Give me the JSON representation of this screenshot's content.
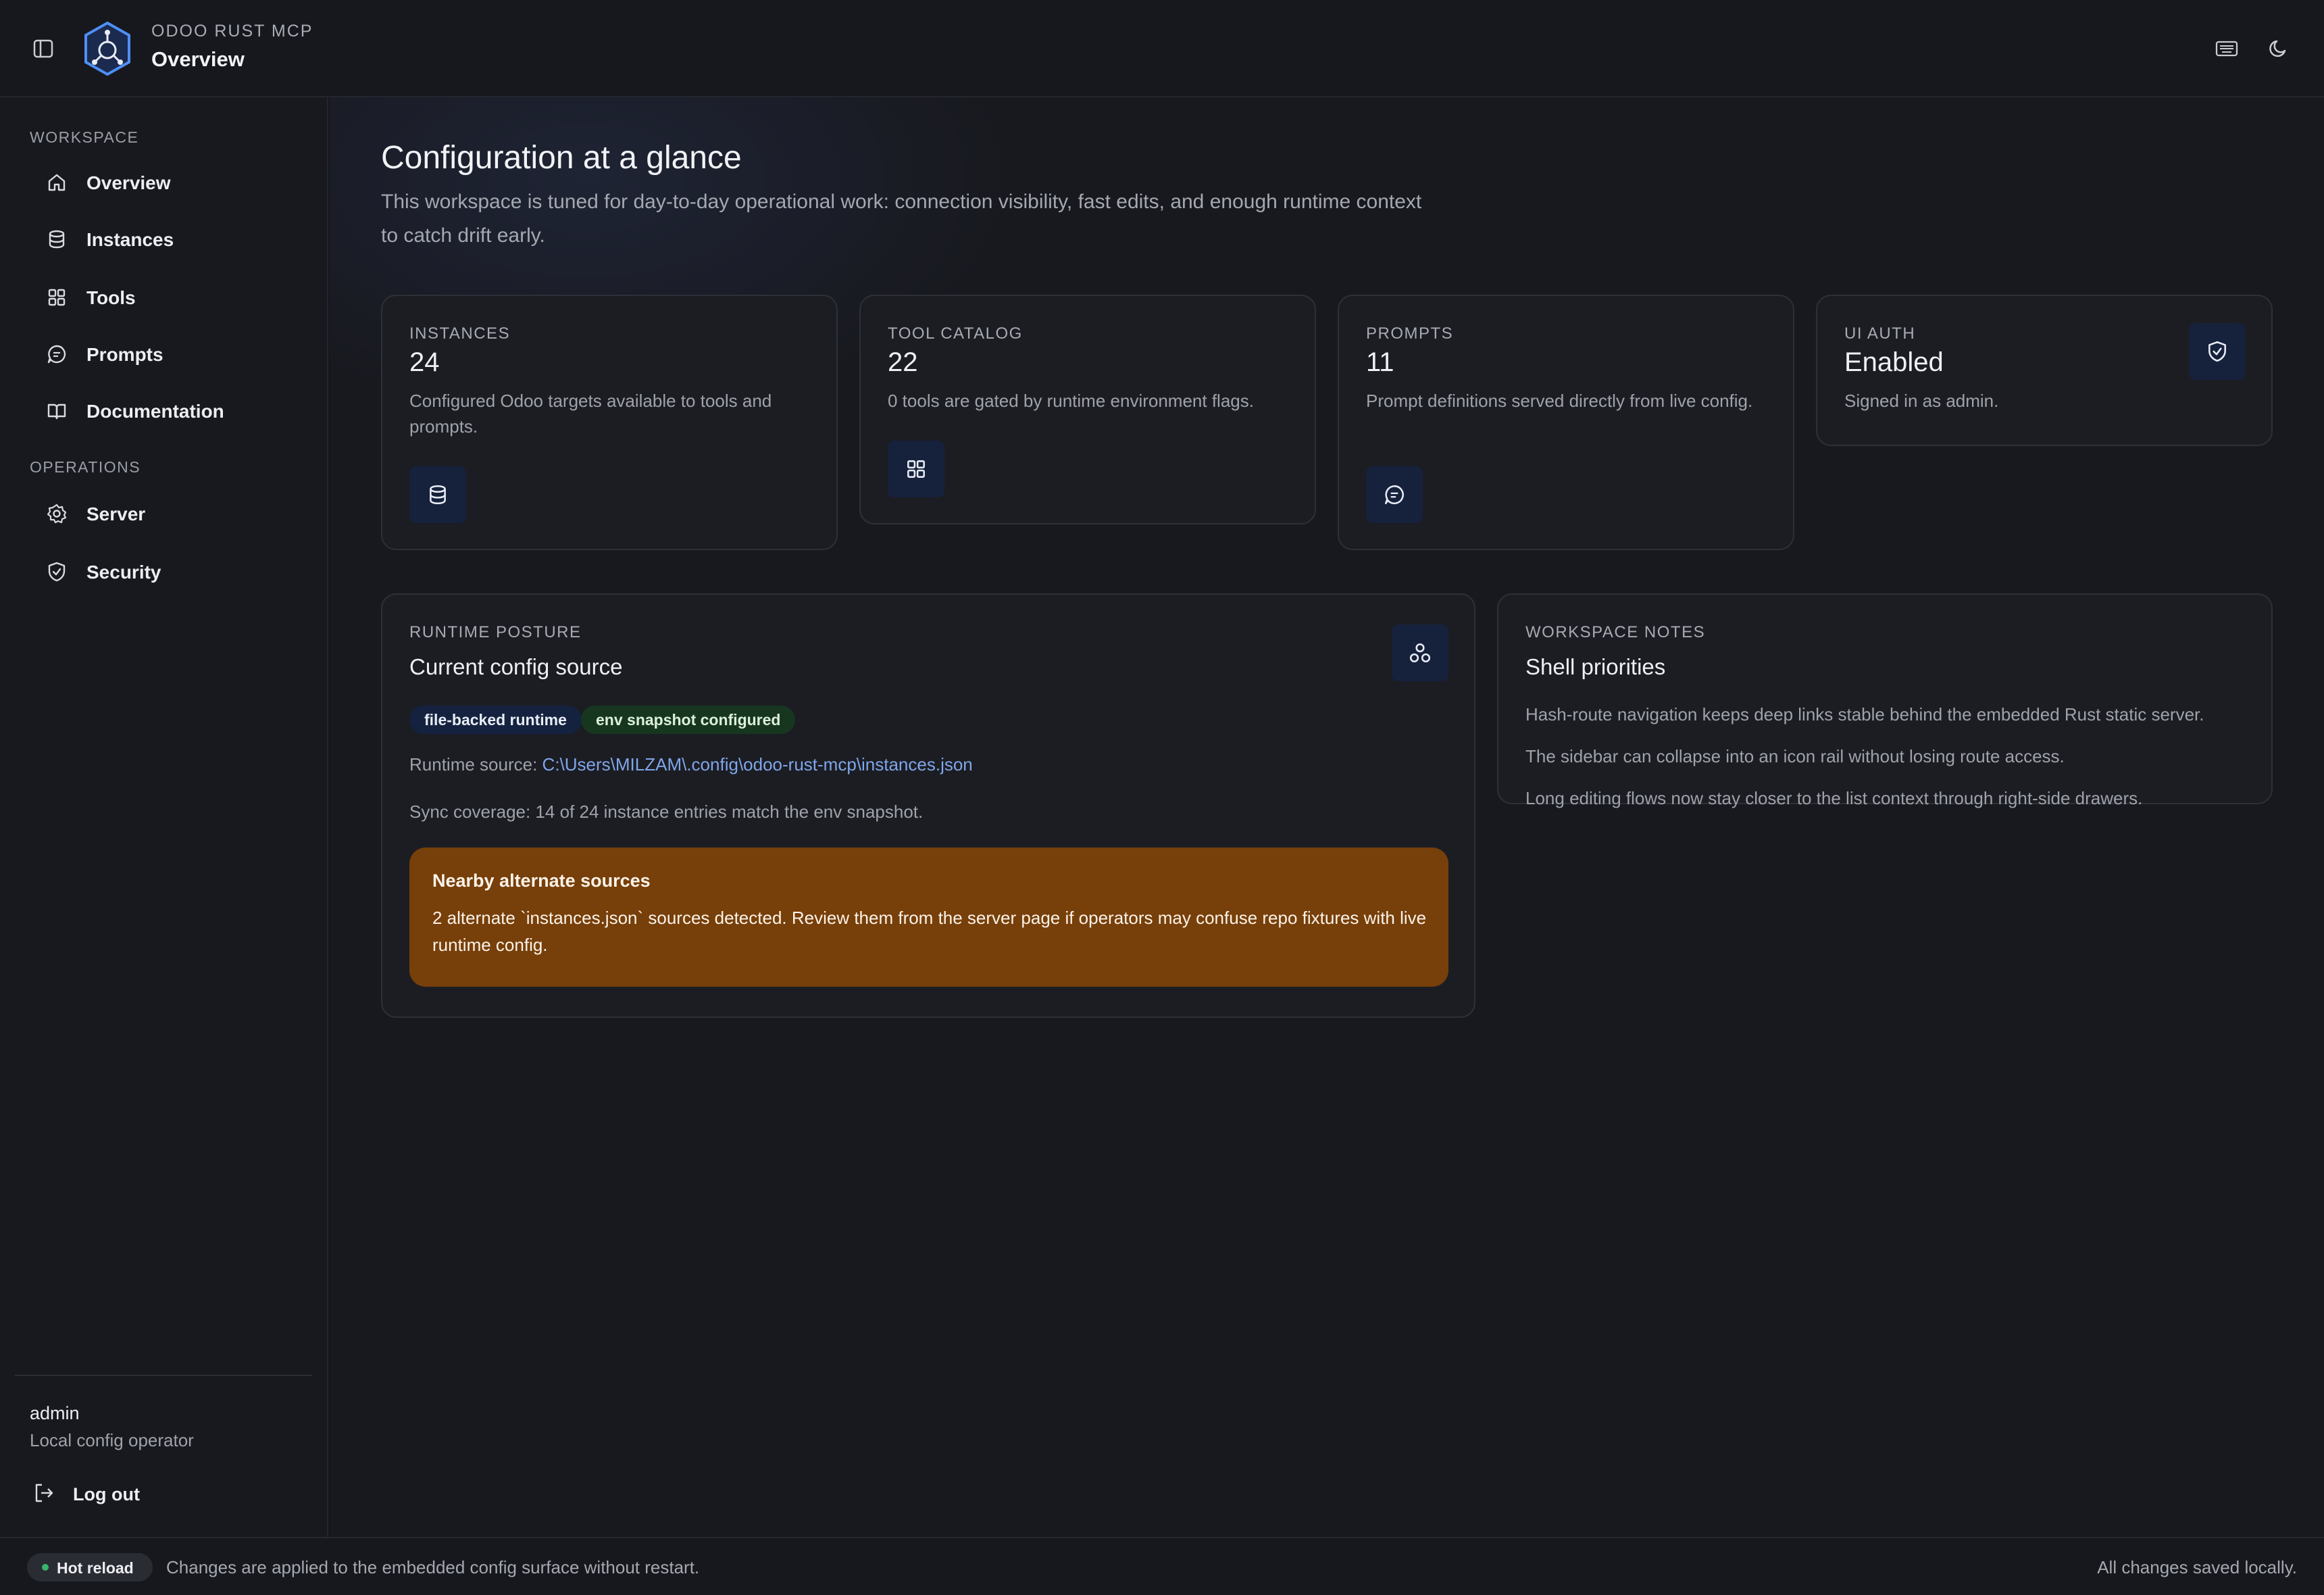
{
  "header": {
    "brand": "ODOO RUST MCP",
    "page_title": "Overview",
    "icons": {
      "sidebar_toggle": "sidebar-toggle-icon",
      "logo": "hexagon-logo-icon",
      "keyboard": "keyboard-icon",
      "theme": "moon-icon"
    }
  },
  "sidebar": {
    "workspace_label": "WORKSPACE",
    "workspace_items": [
      {
        "label": "Overview",
        "icon": "home-icon"
      },
      {
        "label": "Instances",
        "icon": "database-icon"
      },
      {
        "label": "Tools",
        "icon": "grid-icon"
      },
      {
        "label": "Prompts",
        "icon": "chat-icon"
      },
      {
        "label": "Documentation",
        "icon": "book-icon"
      }
    ],
    "operations_label": "OPERATIONS",
    "operations_items": [
      {
        "label": "Server",
        "icon": "gear-icon"
      },
      {
        "label": "Security",
        "icon": "shield-icon"
      }
    ],
    "user": {
      "name": "admin",
      "role": "Local config operator"
    },
    "logout_label": "Log out"
  },
  "main": {
    "title": "Configuration at a glance",
    "description": "This workspace is tuned for day-to-day operational work: connection visibility, fast edits, and enough runtime context to catch drift early.",
    "stats": [
      {
        "label": "INSTANCES",
        "value": "24",
        "desc": "Configured Odoo targets available to tools and prompts.",
        "icon": "database-icon"
      },
      {
        "label": "TOOL CATALOG",
        "value": "22",
        "desc": "0 tools are gated by runtime environment flags.",
        "icon": "grid-icon"
      },
      {
        "label": "PROMPTS",
        "value": "11",
        "desc": "Prompt definitions served directly from live config.",
        "icon": "chat-icon"
      },
      {
        "label": "UI AUTH",
        "value": "Enabled",
        "desc": "Signed in as admin.",
        "icon": "shield-check-icon"
      }
    ],
    "runtime": {
      "label": "RUNTIME POSTURE",
      "title": "Current config source",
      "pills": [
        "file-backed runtime",
        "env snapshot configured"
      ],
      "source_label": "Runtime source:",
      "source_path": "C:\\Users\\MILZAM\\.config\\odoo-rust-mcp\\instances.json",
      "sync": "Sync coverage: 14 of 24 instance entries match the env snapshot.",
      "alert_title": "Nearby alternate sources",
      "alert_body": "2 alternate `instances.json` sources detected. Review them from the server page if operators may confuse repo fixtures with live runtime config.",
      "icon": "nodes-icon"
    },
    "notes": {
      "label": "WORKSPACE NOTES",
      "title": "Shell priorities",
      "items": [
        "Hash-route navigation keeps deep links stable behind the embedded Rust static server.",
        "The sidebar can collapse into an icon rail without losing route access.",
        "Long editing flows now stay closer to the list context through right-side drawers."
      ]
    }
  },
  "footer": {
    "badge": "Hot reload",
    "message": "Changes are applied to the embedded config surface without restart.",
    "status": "All changes saved locally."
  },
  "colors": {
    "accent": "#4f8ff7",
    "alert_bg": "#773f09",
    "pill_green": "#17361f",
    "pill_blue": "#14223f"
  }
}
